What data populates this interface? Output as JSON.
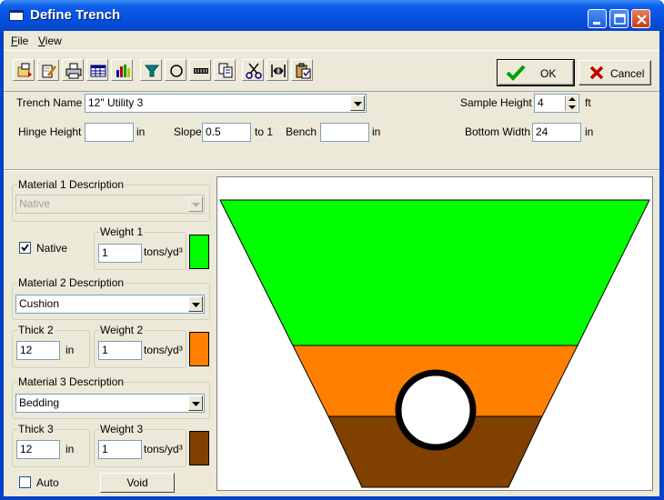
{
  "window": {
    "title": "Define Trench"
  },
  "menu": [
    {
      "accel": "F",
      "rest": "ile"
    },
    {
      "accel": "V",
      "rest": "iew"
    }
  ],
  "toolbar": {
    "tools": [
      "open-icon",
      "edit-icon",
      "print-icon",
      "table-icon",
      "bar-chart-icon",
      "pipe-icon",
      "circle-icon",
      "dimension-icon",
      "copy-icon",
      "cut-icon",
      "fit-icon",
      "paste-icon"
    ],
    "ok_label": "OK",
    "cancel_label": "Cancel"
  },
  "trench": {
    "name_label": "Trench Name",
    "name_value": "12\" Utility 3",
    "sample_height_label": "Sample Height",
    "sample_height_value": "4",
    "sample_height_unit": "ft",
    "hinge_height_label": "Hinge Height",
    "hinge_height_value": "",
    "hinge_height_unit": "in",
    "slope_label": "Slope",
    "slope_value": "0.5",
    "slope_unit": "to 1",
    "bench_label": "Bench",
    "bench_value": "",
    "bench_unit": "in",
    "bottom_width_label": "Bottom Width",
    "bottom_width_value": "24",
    "bottom_width_unit": "in"
  },
  "materials": {
    "m1": {
      "desc_label": "Material 1 Description",
      "desc_value": "Native",
      "native_label": "Native",
      "native_checked": true,
      "weight_label": "Weight 1",
      "weight_value": "1",
      "weight_unit": "tons/yd³",
      "color": "#00ff00"
    },
    "m2": {
      "desc_label": "Material 2 Description",
      "desc_value": "Cushion",
      "thick_label": "Thick 2",
      "thick_value": "12",
      "thick_unit": "in",
      "weight_label": "Weight 2",
      "weight_value": "1",
      "weight_unit": "tons/yd³",
      "color": "#ff8000"
    },
    "m3": {
      "desc_label": "Material 3 Description",
      "desc_value": "Bedding",
      "thick_label": "Thick 3",
      "thick_value": "12",
      "thick_unit": "in",
      "weight_label": "Weight 3",
      "weight_value": "1",
      "weight_unit": "tons/yd³",
      "color": "#804000"
    },
    "auto_label": "Auto",
    "auto_checked": false,
    "void_label": "Void"
  },
  "colors": {
    "material1": "#00ff00",
    "material2": "#ff8000",
    "material3": "#804000",
    "pipe": "#000000"
  }
}
